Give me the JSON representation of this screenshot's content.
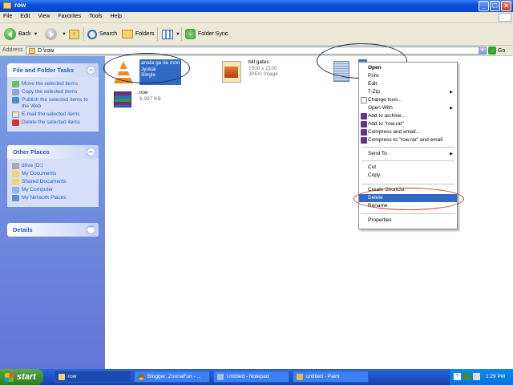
{
  "window": {
    "title": "row"
  },
  "menubar": [
    "File",
    "Edit",
    "View",
    "Favorites",
    "Tools",
    "Help"
  ],
  "toolbar": {
    "back_label": "Back",
    "search_label": "Search",
    "folders_label": "Folders",
    "foldersync_label": "Folder Sync"
  },
  "address": {
    "label": "Address",
    "value": "D:\\row",
    "go_label": "Go"
  },
  "leftpane": {
    "tasks": {
      "title": "File and Folder Tasks",
      "items": [
        "Move the selected items",
        "Copy the selected items",
        "Publish the selected items to the Web",
        "E-mail the selected items",
        "Delete the selected items"
      ]
    },
    "places": {
      "title": "Other Places",
      "items": [
        "drive (D:)",
        "My Documents",
        "Shared Documents",
        "My Computer",
        "My Network Places"
      ]
    },
    "details": {
      "title": "Details"
    }
  },
  "files": [
    {
      "name": "anata ga ita mori",
      "line2": "Jyukai",
      "line3": "Single"
    },
    {
      "name": "bill gates",
      "line2": "1500 x 2100",
      "line3": "JPEG Image"
    },
    {
      "name": "row",
      "line2": "6,997 KB"
    },
    {
      "name": "se",
      "line2": "Te",
      "line3": "1 I"
    }
  ],
  "context_menu": {
    "items": [
      "Open",
      "Print",
      "Edit",
      "7-Zip",
      "Change Icon...",
      "Open With",
      "Add to archive...",
      "Add to \"row.rar\"",
      "Compress and email...",
      "Compress to \"row.rar\" and email",
      "Send To",
      "Cut",
      "Copy",
      "Create Shortcut",
      "Delete",
      "Rename",
      "Properties"
    ],
    "highlighted": "Delete"
  },
  "taskbar": {
    "start_label": "start",
    "tasks": [
      "row",
      "Blogger: ZonnaFun - ...",
      "Untitled - Notepad",
      "untitled - Paint"
    ],
    "clock": "1:29 PM"
  },
  "colors": {
    "selection": "#316ac5",
    "taskbar": "#245edb",
    "start": "#3a8e2e",
    "annotation_red": "#d9322a"
  }
}
